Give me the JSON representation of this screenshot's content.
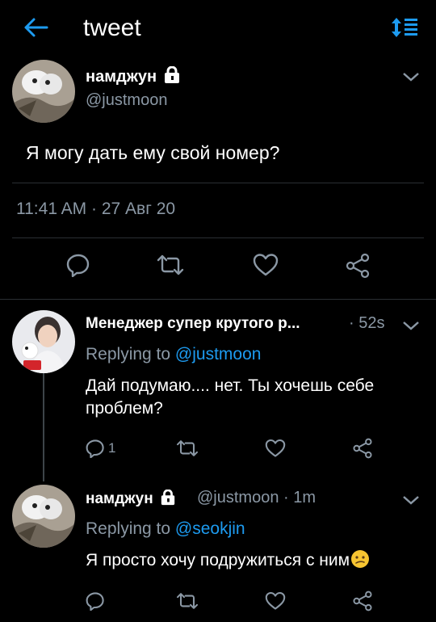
{
  "header": {
    "title": "tweet",
    "back_icon": "back-arrow-icon",
    "sort_icon": "sort-icon",
    "accent": "#1d9bf0"
  },
  "main_tweet": {
    "name": "намджун",
    "handle": "@justmoon",
    "text": "Я могу дать ему свой номер?",
    "time": "11:41 AM",
    "date": "27 Авг 20",
    "actions": [
      "reply-icon",
      "retweet-icon",
      "like-icon",
      "share-icon"
    ]
  },
  "replies": [
    {
      "name": "Менеджер супер крутого р...",
      "time": "52s",
      "replying_prefix": "Replying to",
      "replying_to": "@justmoon",
      "text": "Дай подумаю.... нет. Ты хочешь себе проблем?",
      "reply_count": "1"
    },
    {
      "name": "намджун",
      "handle": "@justmoon",
      "time": "1m",
      "replying_prefix": "Replying to",
      "replying_to": "@seokjin",
      "text": "Я просто хочу подружиться с ним",
      "emoji": "confused-face-emoji"
    }
  ],
  "colors": {
    "background": "#000000",
    "muted": "#8b98a5",
    "divider": "#2a2f33",
    "link": "#1d9bf0"
  }
}
